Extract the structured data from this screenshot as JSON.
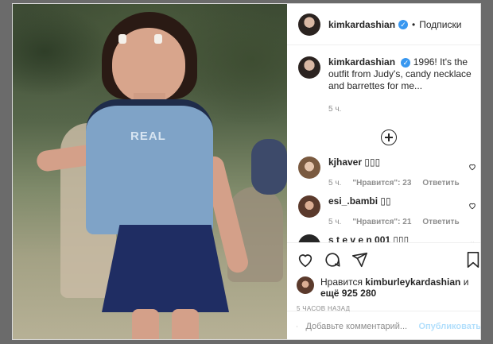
{
  "post": {
    "author": "kimkardashian",
    "follow_label": "Подписки",
    "dot": "•",
    "verified_mark": "✓",
    "photo_shirt_text": "REAL"
  },
  "caption": {
    "username": "kimkardashian",
    "text": "1996! It's the outfit from Judy's, candy necklace and barrettes for me...",
    "time": "5 ч."
  },
  "comments": [
    {
      "username": "kjhaver",
      "text": "▯▯▯",
      "time": "5 ч.",
      "likes": "\"Нравится\": 23",
      "reply": "Ответить"
    },
    {
      "username": "esi_.bambi",
      "text": "▯▯",
      "time": "5 ч.",
      "likes": "\"Нравится\": 21",
      "reply": "Ответить"
    },
    {
      "username": "s t e v e n 001",
      "text": "▯▯▯",
      "time": "",
      "likes": "",
      "reply": ""
    }
  ],
  "likes": {
    "prefix": "Нравится",
    "liker": "kimburleykardashian",
    "middle": "и",
    "others": "ещё 925 280"
  },
  "timestamp": "5 ЧАСОВ НАЗАД",
  "add_comment": {
    "placeholder": "Добавьте комментарий...",
    "publish": "Опубликовать"
  },
  "icons": [
    "heart-icon",
    "comment-icon",
    "share-icon",
    "bookmark-icon",
    "emoji-icon",
    "plus-circle-icon"
  ],
  "colors": {
    "accent": "#3897f0",
    "publish_disabled": "#b2dffc",
    "text": "#262626",
    "muted": "#8e8e8e"
  }
}
